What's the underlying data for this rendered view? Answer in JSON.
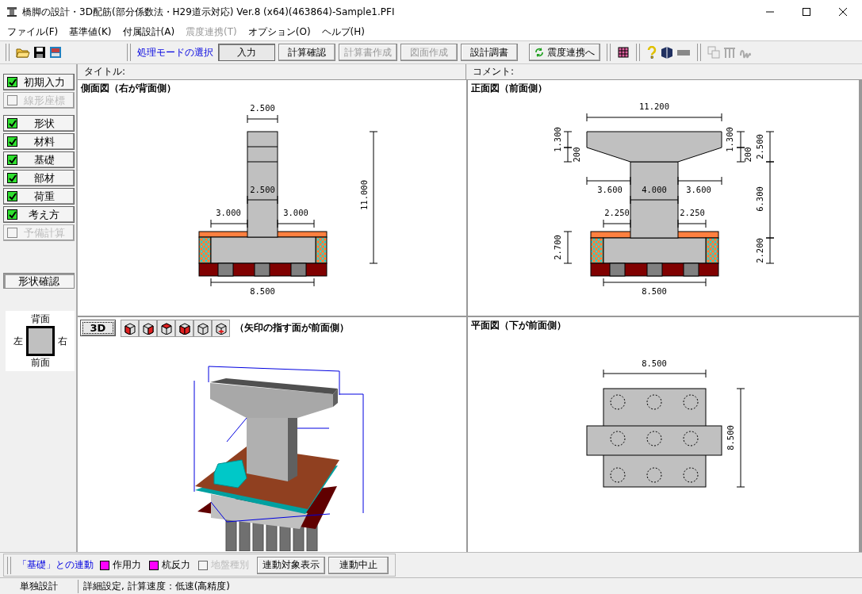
{
  "window": {
    "title": "橋脚の設計・3D配筋(部分係数法・H29道示対応) Ver.8 (x64)(463864)-Sample1.PFI"
  },
  "menu": [
    {
      "label": "ファイル(F)",
      "disabled": false
    },
    {
      "label": "基準値(K)",
      "disabled": false
    },
    {
      "label": "付属設計(A)",
      "disabled": false
    },
    {
      "label": "震度連携(T)",
      "disabled": true
    },
    {
      "label": "オプション(O)",
      "disabled": false
    },
    {
      "label": "ヘルプ(H)",
      "disabled": false
    }
  ],
  "toolbar": {
    "mode_label": "処理モードの選択",
    "mode_buttons": [
      {
        "label": "入力",
        "selected": true,
        "disabled": false
      },
      {
        "label": "計算確認",
        "selected": false,
        "disabled": false
      },
      {
        "label": "計算書作成",
        "selected": false,
        "disabled": true
      },
      {
        "label": "図面作成",
        "selected": false,
        "disabled": true
      },
      {
        "label": "設計調書",
        "selected": false,
        "disabled": false
      }
    ],
    "link_button": "震度連携へ"
  },
  "sidebar": {
    "groups": [
      [
        {
          "label": "初期入力",
          "checked": true,
          "disabled": false
        },
        {
          "label": "線形座標",
          "checked": false,
          "disabled": true
        }
      ],
      [
        {
          "label": "形状",
          "checked": true,
          "disabled": false
        },
        {
          "label": "材料",
          "checked": true,
          "disabled": false
        },
        {
          "label": "基礎",
          "checked": true,
          "disabled": false
        },
        {
          "label": "部材",
          "checked": true,
          "disabled": false
        },
        {
          "label": "荷重",
          "checked": true,
          "disabled": false
        },
        {
          "label": "考え方",
          "checked": true,
          "disabled": false
        },
        {
          "label": "予備計算",
          "checked": false,
          "disabled": true
        }
      ]
    ],
    "shape_button": "形状確認",
    "orientation": {
      "top": "背面",
      "left": "左",
      "right": "右",
      "bottom": "前面"
    }
  },
  "header": {
    "title_label": "タイトル:",
    "comment_label": "コメント:"
  },
  "side_view": {
    "title": "側面図（右が背面側）",
    "dims": [
      "2.500",
      "2.500",
      "3.000",
      "3.000",
      "11.000",
      "8.500"
    ]
  },
  "front_view": {
    "title": "正面図（前面側）",
    "dims": [
      "11.200",
      "1.300",
      "200",
      "1.300",
      "200",
      "2.500",
      "3.600",
      "4.000",
      "3.600",
      "2.250",
      "2.250",
      "6.300",
      "2.700",
      "2.200",
      "8.500"
    ]
  },
  "view_3d": {
    "button": "3D",
    "caption": "（矢印の指す面が前面側）"
  },
  "plan_view": {
    "title": "平面図（下が前面側）",
    "dims": [
      "8.500",
      "8.500"
    ]
  },
  "link_bar": {
    "label": "「基礎」との連動",
    "options": [
      {
        "label": "作用力",
        "checked": true,
        "disabled": false,
        "color": "#ff00ff"
      },
      {
        "label": "杭反力",
        "checked": true,
        "disabled": false,
        "color": "#ff00ff"
      },
      {
        "label": "地盤種別",
        "checked": false,
        "disabled": true
      }
    ],
    "buttons": [
      "連動対象表示",
      "連動中止"
    ]
  },
  "status_bar": [
    "単独設計",
    "詳細設定, 計算速度：低速(高精度)"
  ]
}
